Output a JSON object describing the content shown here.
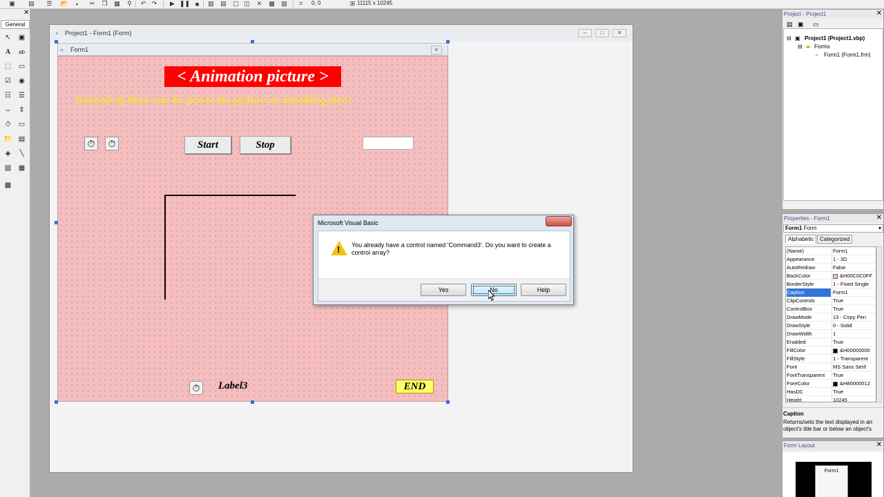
{
  "toolbar": {
    "coords": "0, 0",
    "size": "11115 x 10245"
  },
  "toolbox": {
    "tab": "General"
  },
  "project_window": {
    "title": "Project1 - Form1 (Form)"
  },
  "form": {
    "title": "Form1",
    "back_color": "#f5bdbd",
    "heading": "< Animation picture >",
    "subtitle": "Instead of lines can be put to do picture or anything else!",
    "start_button": "Start",
    "stop_button": "Stop",
    "label3": "Label3",
    "end_button": "END"
  },
  "dialog": {
    "title": "Microsoft Visual Basic",
    "message": "You already have a control named 'Command3'.  Do you want to create a control array?",
    "yes": "Yes",
    "no": "No",
    "help": "Help"
  },
  "project_explorer": {
    "title": "Project - Project1",
    "project": "Project1 (Project1.vbp)",
    "folder": "Forms",
    "form": "Form1 (Form1.frm)"
  },
  "properties": {
    "title": "Properties - Form1",
    "object": "Form1",
    "object_type": "Form",
    "tab_alpha": "Alphabetic",
    "tab_cat": "Categorized",
    "rows": [
      {
        "name": "(Name)",
        "value": "Form1"
      },
      {
        "name": "Appearance",
        "value": "1 - 3D"
      },
      {
        "name": "AutoRedraw",
        "value": "False"
      },
      {
        "name": "BackColor",
        "value": "&H00C0C0FF",
        "swatch": "#ffc0c0"
      },
      {
        "name": "BorderStyle",
        "value": "1 - Fixed Single"
      },
      {
        "name": "Caption",
        "value": "Form1",
        "selected": true
      },
      {
        "name": "ClipControls",
        "value": "True"
      },
      {
        "name": "ControlBox",
        "value": "True"
      },
      {
        "name": "DrawMode",
        "value": "13 - Copy Pen"
      },
      {
        "name": "DrawStyle",
        "value": "0 - Solid"
      },
      {
        "name": "DrawWidth",
        "value": "1"
      },
      {
        "name": "Enabled",
        "value": "True"
      },
      {
        "name": "FillColor",
        "value": "&H00000000",
        "swatch": "#000000"
      },
      {
        "name": "FillStyle",
        "value": "1 - Transparent"
      },
      {
        "name": "Font",
        "value": "MS Sans Serif"
      },
      {
        "name": "FontTransparent",
        "value": "True"
      },
      {
        "name": "ForeColor",
        "value": "&H80000012",
        "swatch": "#000000"
      },
      {
        "name": "HasDC",
        "value": "True"
      },
      {
        "name": "Height",
        "value": "10245"
      }
    ],
    "desc_title": "Caption",
    "desc_text": "Returns/sets the text displayed in an object's title bar or below an object's"
  },
  "form_layout": {
    "title": "Form Layout",
    "form_label": "Form1"
  }
}
